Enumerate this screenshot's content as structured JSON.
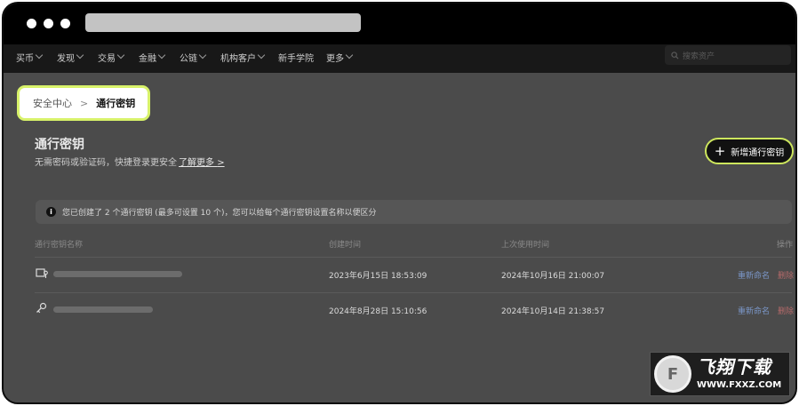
{
  "nav": {
    "items": [
      "买币",
      "发现",
      "交易",
      "金融",
      "公链",
      "机构客户",
      "新手学院",
      "更多"
    ],
    "search_placeholder": "搜索资产"
  },
  "breadcrumb": {
    "parent": "安全中心",
    "separator": ">",
    "current": "通行密钥"
  },
  "page": {
    "title": "通行密钥",
    "subtitle": "无需密码或验证码，快捷登录更安全",
    "learn_more": "了解更多",
    "learn_more_chevron": ">",
    "add_button": "新增通行密钥"
  },
  "notice": "您已创建了 2 个通行密钥 (最多可设置 10 个)，您可以给每个通行密钥设置名称以便区分",
  "table": {
    "headers": [
      "通行密钥名称",
      "创建时间",
      "上次使用时间",
      "操作"
    ],
    "rows": [
      {
        "name_blurred": true,
        "icon": "laptop-key-icon",
        "created": "2023年6月15日 18:53:09",
        "last_used": "2024年10月16日 21:00:07",
        "rename": "重新命名",
        "delete": "删除"
      },
      {
        "name_blurred": true,
        "icon": "key-icon",
        "created": "2024年8月28日 15:10:56",
        "last_used": "2024年10月14日 21:38:57",
        "rename": "重新命名",
        "delete": "删除"
      }
    ]
  },
  "watermark": {
    "text": "飞翔下载",
    "url": "WWW.FXXZ.COM"
  },
  "colors": {
    "accent": "#d8f26a",
    "overlay": "#4b4b4b",
    "link": "#7b97c9",
    "danger": "#b56a6a"
  }
}
